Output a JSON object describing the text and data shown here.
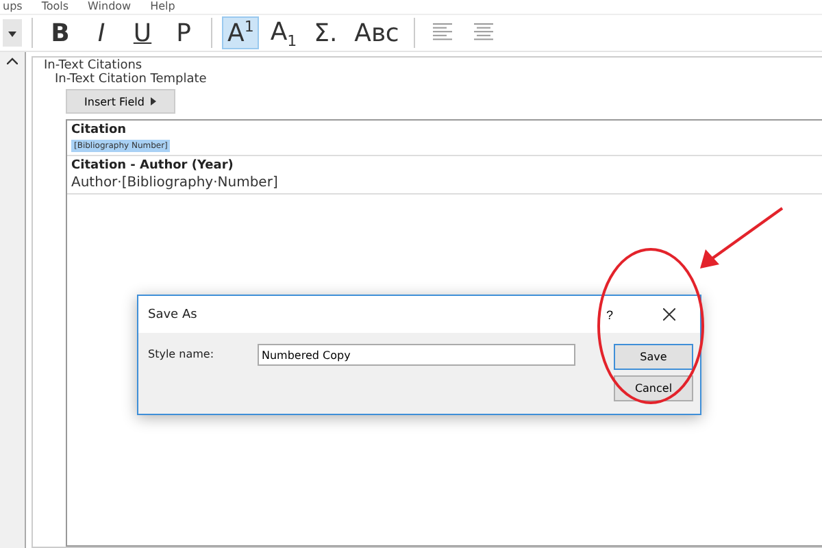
{
  "menu_bar": [
    "ups",
    "Tools",
    "Window",
    "Help"
  ],
  "toolbar": [
    {
      "kind": "bold",
      "label": "B",
      "selected": false
    },
    {
      "kind": "italic",
      "label": "I",
      "selected": false
    },
    {
      "kind": "underline",
      "label": "U",
      "selected": false
    },
    {
      "kind": "text",
      "label": "P",
      "selected": false
    },
    {
      "kind": "text",
      "label": "A$^{1}$",
      "selected": true
    },
    {
      "kind": "text",
      "label": "A$_{1}$",
      "selected": false
    },
    {
      "kind": "text",
      "label": "Σ.",
      "selected": false
    },
    {
      "kind": "text",
      "label": "Aʙᴄ",
      "selected": false
    },
    {
      "kind": "align-left",
      "selected": false
    },
    {
      "kind": "align-center",
      "selected": false
    }
  ],
  "section": {
    "title": "In-Text Citations",
    "group_title": "In-Text Citation Template",
    "insert_button": "Insert Field",
    "templates": [
      {
        "heading": "Citation",
        "body": "[Bibliography Number]",
        "highlighted": true
      },
      {
        "heading": "Citation - Author (Year)",
        "body": "Author·[Bibliography·Number]",
        "highlighted": false
      }
    ]
  },
  "dialog": {
    "title": "Save As",
    "help": "?",
    "label": "Style name:",
    "value": "Numbered Copy",
    "buttons": [
      {
        "label": "Save",
        "default": true
      },
      {
        "label": "Cancel",
        "default": false
      }
    ]
  }
}
